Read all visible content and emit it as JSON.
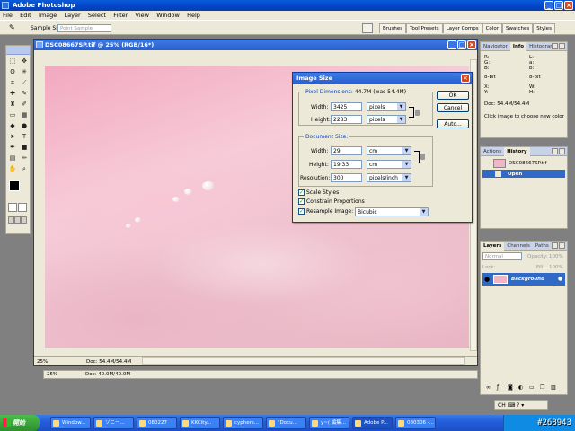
{
  "app": {
    "title": "Adobe Photoshop"
  },
  "menu": [
    "File",
    "Edit",
    "Image",
    "Layer",
    "Select",
    "Filter",
    "View",
    "Window",
    "Help"
  ],
  "options_bar": {
    "sample_size_label": "Sample Size:",
    "sample_size_value": "Point Sample"
  },
  "palette_well_tabs": [
    "Brushes",
    "Tool Presets",
    "Layer Comps",
    "Color",
    "Swatches",
    "Styles"
  ],
  "document": {
    "title": "DSC08667SP.tif @ 25% (RGB/16*)",
    "zoom": "25%",
    "doc_info": "Doc: 54.4M/54.4M"
  },
  "status2": {
    "zoom": "25%",
    "doc_info": "Doc: 40.0M/40.0M"
  },
  "image_size_dialog": {
    "title": "Image Size",
    "pixel_dimensions_label": "Pixel Dimensions:",
    "pixel_dimensions_value": "44.7M (was 54.4M)",
    "pixel_width_label": "Width:",
    "pixel_width_value": "3425",
    "pixel_width_unit": "pixels",
    "pixel_height_label": "Height:",
    "pixel_height_value": "2283",
    "pixel_height_unit": "pixels",
    "document_size_label": "Document Size:",
    "doc_width_label": "Width:",
    "doc_width_value": "29",
    "doc_width_unit": "cm",
    "doc_height_label": "Height:",
    "doc_height_value": "19.33",
    "doc_height_unit": "cm",
    "resolution_label": "Resolution:",
    "resolution_value": "300",
    "resolution_unit": "pixels/inch",
    "scale_styles": "Scale Styles",
    "constrain_proportions": "Constrain Proportions",
    "resample_label": "Resample Image:",
    "resample_value": "Bicubic",
    "ok": "OK",
    "cancel": "Cancel",
    "auto": "Auto..."
  },
  "info_panel": {
    "tabs": [
      "Navigator",
      "Info",
      "Histogram"
    ],
    "left_channels": "R:\nG:\nB:",
    "right_channels": "L:\na:\nb:",
    "bit_left": "8-bit",
    "bit_right": "8-bit",
    "xy": "X:\nY:",
    "wh": "W:\nH:",
    "doc": "Doc: 54.4M/54.4M",
    "hint": "Click image to choose new color"
  },
  "history_panel": {
    "tabs": [
      "Actions",
      "History"
    ],
    "snapshot": "DSC08667SP.tif",
    "step": "Open"
  },
  "layers_panel": {
    "tabs": [
      "Layers",
      "Channels",
      "Paths"
    ],
    "blend_mode": "Normal",
    "opacity_label": "Opacity:",
    "opacity_value": "100%",
    "lock_label": "Lock:",
    "fill_label": "Fill:",
    "fill_value": "100%",
    "layer_name": "Background"
  },
  "taskbar": {
    "start": "開始",
    "tasks": [
      "Window...",
      "ソニー...",
      "080227",
      "KKCity...",
      "cyphers...",
      "\"Docu...",
      "y~( 編集...",
      "Adobe P...",
      "080306 -..."
    ]
  },
  "language_bar": {
    "text": "CH"
  },
  "watermark": "#268943"
}
